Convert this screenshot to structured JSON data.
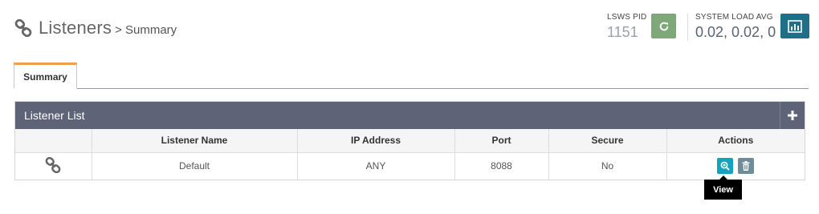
{
  "header": {
    "title": "Listeners",
    "breadcrumb": "> Summary",
    "icon": "link-icon"
  },
  "stats": {
    "pid_label": "LSWS PID",
    "pid_value": "1151",
    "restart_icon": "refresh-icon",
    "load_label": "SYSTEM LOAD AVG",
    "load_value": "0.02, 0.02, 0",
    "chart_icon": "bar-chart-icon"
  },
  "tabs": [
    {
      "label": "Summary",
      "active": true
    }
  ],
  "panel": {
    "title": "Listener List",
    "add_icon": "plus-icon"
  },
  "table": {
    "columns": [
      "",
      "Listener Name",
      "IP Address",
      "Port",
      "Secure",
      "Actions"
    ],
    "rows": [
      {
        "icon": "link-icon",
        "name": "Default",
        "ip": "ANY",
        "port": "8088",
        "secure": "No"
      }
    ]
  },
  "tooltip": "View",
  "colors": {
    "panel_header": "#5e6378",
    "tab_accent": "#f0a04a",
    "restart_button": "#7fa87a",
    "chart_button": "#1f6f89",
    "view_button": "#14a2c2",
    "delete_button": "#6f8c99"
  }
}
